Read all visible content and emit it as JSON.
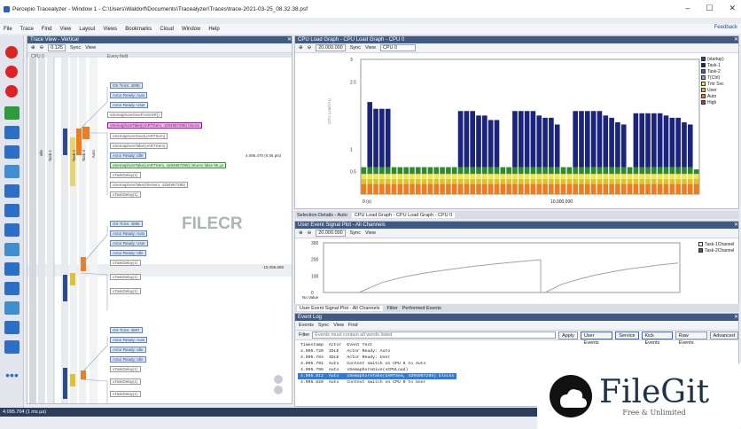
{
  "window": {
    "title": "Percepio Tracealyzer - Window 1 - C:\\Users\\Waldorf\\Documents\\Tracealyzer\\Traces\\trace-2021-03-25_08.32.38.psf",
    "controls": [
      "–",
      "☐",
      "✕"
    ]
  },
  "menu": {
    "items": [
      "File",
      "Trace",
      "Find",
      "View",
      "Layout",
      "Views",
      "Bookmarks",
      "Cloud",
      "Window",
      "Help"
    ],
    "feedback": "Feedback"
  },
  "trace_view": {
    "title": "Trace View - Vertical",
    "zoom": "0.125",
    "sync": "Sync",
    "view": "View",
    "cpu_label": "CPU 0",
    "every_field": "Every field",
    "time_label_1": "4.095.470 (0.55 pts)",
    "time_label_2": "-15.096.688",
    "columns": [
      "Idle",
      "Task-1",
      "Task-2",
      "Task-3",
      "Auto"
    ],
    "events_a": [
      "OS Ticks: 4095",
      "Actor Ready: Auto",
      "Actor Ready: User",
      "xSemaphoreGiveFromISR()",
      "xSemaphoreTake(UARTSem, 4294967295) blocks",
      "xSemaphoreGive(UARTSem)",
      "xSemaphoreTake(UARTSem)",
      "Actor Ready: Idle",
      "xSemaphoreTake(UARTSem, 4294967295) returns false 85 µs",
      "xTaskDelay(1)",
      "xSemaphoreTake(FileSem, 4294967295)",
      "xTaskDelay(1)"
    ],
    "events_b": [
      "OS Ticks: 4096",
      "Actor Ready: Auto",
      "Actor Ready: User",
      "Actor Ready: Idle",
      "xTaskDelay(1)",
      "xTaskDelay(1)",
      "xTaskDelay(1)"
    ],
    "events_c": [
      "OS Ticks: 4097",
      "Actor Ready: Auto",
      "Actor Ready: Idle",
      "Actor Ready: Idle",
      "xTaskDelay(1)",
      "xTaskDelay(1)",
      "xTaskDelay(1)"
    ]
  },
  "cpu_panel": {
    "title": "CPU Load Graph - CPU Load Graph - CPU 0",
    "zoom": "20.000.000",
    "sync": "Sync",
    "view": "View",
    "cpu_select": "CPU 0",
    "y_axis_label": "CPU Load (%)",
    "x_tick_1": "0 (s)",
    "x_tick_2": "10.000.000"
  },
  "selection_bar": {
    "tabs": [
      "Selection Details - Auto",
      "CPU Load Graph - CPU Load Graph - CPU 0"
    ]
  },
  "user_panel": {
    "title": "User Event Signal Plot - All Channels",
    "zoom": "20.000.000",
    "sync": "Sync",
    "view": "View",
    "no_value": "No Value",
    "legend": [
      "Task-1Channel",
      "Task-2Channel"
    ]
  },
  "user_bar": {
    "tabs": [
      "User Event Signal Plot - All Channels",
      "Filter",
      "Performed Events"
    ]
  },
  "event_log": {
    "title": "Event Log",
    "tabs": [
      "Events",
      "Sync",
      "View",
      "Find"
    ],
    "filter_label": "Filter",
    "filter_placeholder": "Events must contain all words listed",
    "buttons": [
      "Apply",
      "User Events",
      "Service",
      "Kick Events",
      "Raw Events",
      "Advanced"
    ],
    "headers": [
      "Timestamp",
      "Actor",
      "Event Text"
    ],
    "rows": [
      {
        "ts": "4.095.720",
        "actor": "IDLE",
        "text": "Actor Ready: Auto"
      },
      {
        "ts": "4.095.784",
        "actor": "IDLE",
        "text": "Actor Ready: User"
      },
      {
        "ts": "4.095.791",
        "actor": "Auto",
        "text": "Context switch on CPU 0 to Auto"
      },
      {
        "ts": "4.095.798",
        "actor": "Auto",
        "text": "xSemaphoreGive(xCPULoad)"
      },
      {
        "ts": "4.095.812",
        "actor": "Auto",
        "text": "xSemaphoreTake(UARTSem, 4294967295) blocks"
      },
      {
        "ts": "4.095.820",
        "actor": "Auto",
        "text": "Context switch on CPU 0 to User"
      }
    ],
    "selected_row": 4
  },
  "statusbar": "4.095.704 (1 ms µs)",
  "watermark": "FILECR",
  "filegit": {
    "brand": "FileGit",
    "tagline": "Free & Unlimited"
  },
  "chart_data": [
    {
      "type": "bar",
      "title": "CPU Load Graph - CPU 0",
      "ylim": [
        0,
        3
      ],
      "yticks": [
        "3",
        "2.5",
        "1",
        "0.5"
      ],
      "legend": [
        "(startup)",
        "Task-1",
        "Task-2",
        "T(Ctrl)",
        "Tmr Svc",
        "User",
        "Auto",
        "High"
      ],
      "colors": [
        "#2b3f8a",
        "#1a237e",
        "#2f6ad6",
        "#7aa7e6",
        "#f2e64a",
        "#e0c230",
        "#ef7d1e",
        "#d12d2d"
      ],
      "bars": [
        0.6,
        2.05,
        1.9,
        1.9,
        1.9,
        0.6,
        0.6,
        0.6,
        0.6,
        0.6,
        0.6,
        0.6,
        0.6,
        0.6,
        0.6,
        0.6,
        1.85,
        1.85,
        1.85,
        1.75,
        1.75,
        1.65,
        1.65,
        0.6,
        0.6,
        1.85,
        1.85,
        1.85,
        1.85,
        1.75,
        1.7,
        1.7,
        1.55,
        0.6,
        0.6,
        1.85,
        1.85,
        1.85,
        1.85,
        1.85,
        1.75,
        1.7,
        1.6,
        1.55,
        0.6,
        1.8,
        1.8,
        1.8,
        1.8,
        1.8,
        1.75,
        1.7,
        1.7,
        1.6,
        1.55,
        0.55
      ]
    },
    {
      "type": "line",
      "title": "User Event Signal Plot - All Channels",
      "ylim": [
        0,
        300
      ],
      "yticks": [
        "300",
        "200",
        "100",
        "0"
      ],
      "series": [
        {
          "name": "Task-1Channel",
          "values": [
            0,
            60,
            95,
            120,
            140,
            158,
            173,
            186,
            198
          ]
        },
        {
          "name": "Task-2Channel",
          "values": [
            0,
            50,
            80,
            105,
            125,
            142,
            155,
            168,
            178
          ]
        }
      ]
    }
  ]
}
